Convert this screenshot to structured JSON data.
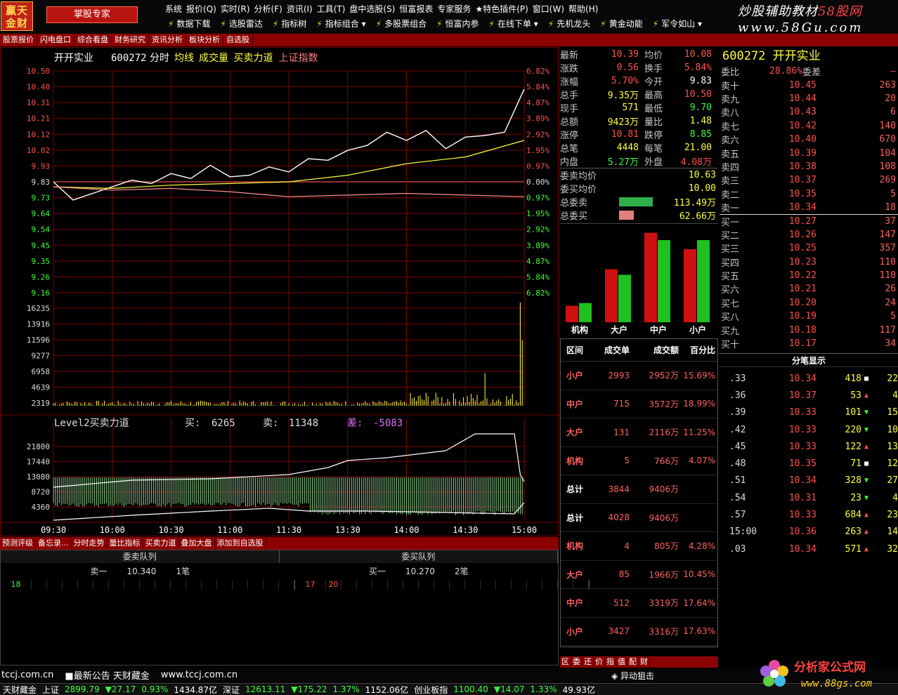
{
  "app": {
    "logo_line1": "赢天",
    "logo_line2": "金财",
    "expert_button": "掌股专家",
    "brand_line1_a": "炒股辅助教材",
    "brand_line1_b": "58股网",
    "brand_line2": "www.58Gu.com"
  },
  "menu": [
    "系统",
    "报价(Q)",
    "实时(R)",
    "分析(F)",
    "资讯(I)",
    "工具(T)",
    "盘中选股(S)",
    "恒富报表",
    "专家服务",
    "★特色插件(P)",
    "窗口(W)",
    "帮助(H)"
  ],
  "toolbar": [
    "数据下载",
    "选股雷达",
    "指标树",
    "指标组合 ▾",
    "多股票组合",
    "恒富内参",
    "在线下单 ▾",
    "先机龙头",
    "黄金动能",
    "军令如山 ▾"
  ],
  "nav_tabs": [
    "股票报价",
    "闪电盘口",
    "综合看盘",
    "财务研究",
    "资讯分析",
    "板块分析",
    "自选股"
  ],
  "chart": {
    "header_name": "开开实业",
    "header_code": "600272",
    "header_items": [
      "分时",
      "均线",
      "成交量",
      "买卖力道",
      "上证指数"
    ],
    "price_ticks": [
      "10.50",
      "10.40",
      "10.31",
      "10.21",
      "10.12",
      "10.02",
      "9.93",
      "9.83",
      "9.73",
      "9.64",
      "9.54",
      "9.45",
      "9.35",
      "9.26",
      "9.16"
    ],
    "pct_ticks": [
      "6.82%",
      "5.84%",
      "4.87%",
      "3.89%",
      "2.92%",
      "1.95%",
      "0.97%",
      "0.00%",
      "0.97%",
      "1.95%",
      "2.92%",
      "3.89%",
      "4.87%",
      "5.84%",
      "6.82%"
    ],
    "volume_ticks": [
      "16235",
      "13916",
      "11596",
      "9277",
      "6958",
      "4639",
      "2319"
    ],
    "level2_title": "Level2买卖力道",
    "level2_buy_label": "买:",
    "level2_buy": "6265",
    "level2_sell_label": "卖:",
    "level2_sell": "11348",
    "level2_diff_label": "差:",
    "level2_diff": "-5083",
    "power_ticks": [
      "21800",
      "17440",
      "13080",
      "8720",
      "4360"
    ],
    "time_ticks": [
      "09:30",
      "10:00",
      "10:30",
      "11:00",
      "11:30",
      "13:30",
      "14:00",
      "14:30",
      "15:00"
    ]
  },
  "chart_data": {
    "type": "line",
    "title": "",
    "x_labels": [
      "09:30",
      "10:00",
      "10:30",
      "11:00",
      "11:30",
      "13:30",
      "14:00",
      "14:30",
      "15:00"
    ],
    "price_ylim": [
      9.16,
      10.5
    ],
    "prev_close": 9.83,
    "series": [
      {
        "name": "分时",
        "x": [
          0,
          10,
          20,
          30,
          40,
          50,
          60,
          70,
          80,
          90,
          100,
          110,
          120,
          130,
          140,
          150,
          160,
          170,
          180,
          190,
          200,
          210,
          220,
          230,
          240
        ],
        "values": [
          9.83,
          9.72,
          9.76,
          9.8,
          9.84,
          9.82,
          9.88,
          9.85,
          9.93,
          9.86,
          9.87,
          9.92,
          9.89,
          9.97,
          9.96,
          10.02,
          10.05,
          10.13,
          10.08,
          10.14,
          10.03,
          10.1,
          10.11,
          10.13,
          10.39
        ]
      },
      {
        "name": "均线",
        "x": [
          0,
          30,
          60,
          90,
          120,
          150,
          180,
          210,
          240
        ],
        "values": [
          9.8,
          9.79,
          9.81,
          9.82,
          9.83,
          9.87,
          9.94,
          9.98,
          10.08
        ]
      },
      {
        "name": "上证指数",
        "x": [
          0,
          30,
          60,
          90,
          120,
          150,
          180,
          210,
          240
        ],
        "values": [
          9.8,
          9.78,
          9.79,
          9.77,
          9.74,
          9.75,
          9.76,
          9.75,
          9.74
        ]
      }
    ]
  },
  "quote": {
    "rows": [
      {
        "l": "最新",
        "v": "10.39",
        "vc": "red",
        "l2": "均价",
        "v2": "10.08",
        "v2c": "red"
      },
      {
        "l": "涨跌",
        "v": "0.56",
        "vc": "red",
        "l2": "换手",
        "v2": "5.84%",
        "v2c": "red"
      },
      {
        "l": "涨幅",
        "v": "5.70%",
        "vc": "red",
        "l2": "今开",
        "v2": "9.83",
        "v2c": "wht"
      },
      {
        "l": "总手",
        "v": "9.35万",
        "vc": "yel",
        "l2": "最高",
        "v2": "10.50",
        "v2c": "red"
      },
      {
        "l": "现手",
        "v": "571",
        "vc": "yel",
        "l2": "最低",
        "v2": "9.70",
        "v2c": "green"
      },
      {
        "l": "总额",
        "v": "9423万",
        "vc": "yel",
        "l2": "量比",
        "v2": "1.48",
        "v2c": "yel"
      },
      {
        "l": "涨停",
        "v": "10.81",
        "vc": "red",
        "l2": "跌停",
        "v2": "8.85",
        "v2c": "green"
      },
      {
        "l": "总笔",
        "v": "4448",
        "vc": "yel",
        "l2": "每笔",
        "v2": "21.00",
        "v2c": "yel"
      },
      {
        "l": "内盘",
        "v": "5.27万",
        "vc": "green",
        "l2": "外盘",
        "v2": "4.08万",
        "v2c": "red"
      }
    ],
    "weituo": [
      {
        "l": "委卖均价",
        "v": "10.63"
      },
      {
        "l": "委买均价",
        "v": "10.00"
      },
      {
        "l": "总委卖",
        "v": "113.49万",
        "bar": 0.8,
        "color": "#2fb04a"
      },
      {
        "l": "总委买",
        "v": "62.66万",
        "bar": 0.35,
        "color": "#e08080"
      }
    ]
  },
  "bars": {
    "labels": [
      "机构",
      "大户",
      "中户",
      "小户"
    ],
    "pairs": [
      [
        0.18,
        0.21
      ],
      [
        0.58,
        0.52
      ],
      [
        0.98,
        0.9
      ],
      [
        0.8,
        0.9
      ]
    ]
  },
  "flow": {
    "headers": [
      "区间",
      "成交单",
      "成交额",
      "百分比"
    ],
    "rows": [
      {
        "n": "小户",
        "a": "2993",
        "b": "2952万",
        "p": "15.69%"
      },
      {
        "n": "中户",
        "a": "715",
        "b": "3572万",
        "p": "18.99%"
      },
      {
        "n": "大户",
        "a": "131",
        "b": "2116万",
        "p": "11.25%"
      },
      {
        "n": "机构",
        "a": "5",
        "b": "766万",
        "p": "4.07%"
      },
      {
        "n": "总计",
        "a": "3844",
        "b": "9406万",
        "p": ""
      },
      {
        "n": "总计",
        "a": "4028",
        "b": "9406万",
        "p": ""
      },
      {
        "n": "机构",
        "a": "4",
        "b": "805万",
        "p": "4.28%"
      },
      {
        "n": "大户",
        "a": "85",
        "b": "1966万",
        "p": "10.45%"
      },
      {
        "n": "中户",
        "a": "512",
        "b": "3319万",
        "p": "17.64%"
      },
      {
        "n": "小户",
        "a": "3427",
        "b": "3316万",
        "p": "17.63%"
      }
    ]
  },
  "small_tabs": [
    "区",
    "委",
    "还",
    "价",
    "指",
    "值",
    "配",
    "财"
  ],
  "order_book": {
    "title": "600272 开开实业",
    "weibi_label": "委比",
    "weibi": "28.86%",
    "weicha_label": "委差",
    "weicha": "—",
    "sells": [
      {
        "l": "卖十",
        "p": "10.45",
        "q": "263"
      },
      {
        "l": "卖九",
        "p": "10.44",
        "q": "20"
      },
      {
        "l": "卖八",
        "p": "10.43",
        "q": "6"
      },
      {
        "l": "卖七",
        "p": "10.42",
        "q": "140"
      },
      {
        "l": "卖六",
        "p": "10.40",
        "q": "670"
      },
      {
        "l": "卖五",
        "p": "10.39",
        "q": "104"
      },
      {
        "l": "卖四",
        "p": "10.38",
        "q": "108"
      },
      {
        "l": "卖三",
        "p": "10.37",
        "q": "269"
      },
      {
        "l": "卖二",
        "p": "10.35",
        "q": "5"
      },
      {
        "l": "卖一",
        "p": "10.34",
        "q": "18"
      }
    ],
    "buys": [
      {
        "l": "买一",
        "p": "10.27",
        "q": "37"
      },
      {
        "l": "买二",
        "p": "10.26",
        "q": "147"
      },
      {
        "l": "买三",
        "p": "10.25",
        "q": "357"
      },
      {
        "l": "买四",
        "p": "10.23",
        "q": "110"
      },
      {
        "l": "买五",
        "p": "10.22",
        "q": "110"
      },
      {
        "l": "买六",
        "p": "10.21",
        "q": "26"
      },
      {
        "l": "买七",
        "p": "10.20",
        "q": "24"
      },
      {
        "l": "买八",
        "p": "10.19",
        "q": "5"
      },
      {
        "l": "买九",
        "p": "10.18",
        "q": "117"
      },
      {
        "l": "买十",
        "p": "10.17",
        "q": "34"
      }
    ]
  },
  "ticks_title": "分笔显示",
  "ticks": [
    {
      "t": ".33",
      "p": "10.34",
      "v": "418",
      "d": "■",
      "dc": "wht",
      "n": "22"
    },
    {
      "t": ".36",
      "p": "10.37",
      "v": "53",
      "d": "▲",
      "dc": "red",
      "n": "4"
    },
    {
      "t": ".39",
      "p": "10.33",
      "v": "101",
      "d": "▼",
      "dc": "green",
      "n": "15"
    },
    {
      "t": ".42",
      "p": "10.33",
      "v": "220",
      "d": "▼",
      "dc": "green",
      "n": "10"
    },
    {
      "t": ".45",
      "p": "10.33",
      "v": "122",
      "d": "▲",
      "dc": "red",
      "n": "13"
    },
    {
      "t": ".48",
      "p": "10.35",
      "v": "71",
      "d": "■",
      "dc": "wht",
      "n": "12"
    },
    {
      "t": ".51",
      "p": "10.34",
      "v": "328",
      "d": "▼",
      "dc": "green",
      "n": "27"
    },
    {
      "t": ".54",
      "p": "10.31",
      "v": "23",
      "d": "▼",
      "dc": "green",
      "n": "4"
    },
    {
      "t": ".57",
      "p": "10.33",
      "v": "684",
      "d": "▲",
      "dc": "red",
      "n": "23"
    },
    {
      "t": "15:00",
      "p": "10.36",
      "v": "263",
      "d": "▲",
      "dc": "red",
      "n": "14"
    },
    {
      "t": ".03",
      "p": "10.34",
      "v": "571",
      "d": "▲",
      "dc": "red",
      "n": "32"
    }
  ],
  "sub_tabs": [
    "预测评级",
    "备忘录...",
    "分时走势",
    "量比指标",
    "买卖力道",
    "叠加大盘",
    "添加到自选股"
  ],
  "queue": {
    "sell_title": "委卖队列",
    "buy_title": "委买队列",
    "sell_level": "卖一",
    "sell_price": "10.340",
    "sell_count": "1笔",
    "buy_level": "买一",
    "buy_price": "10.270",
    "buy_count": "2笔",
    "sell_cells": [
      "18"
    ],
    "buy_cells": [
      "17",
      "20"
    ]
  },
  "status": {
    "site": "tccj.com.cn",
    "notice": "最新公告",
    "notice2": "天财藏金",
    "site2": "www.tccj.com.cn",
    "alert": "异动狙击",
    "bottom": [
      {
        "t": "天财藏金",
        "c": "wht"
      },
      {
        "t": "上证",
        "c": "wht"
      },
      {
        "t": "2899.79",
        "c": "green"
      },
      {
        "t": "▼27.17",
        "c": "green"
      },
      {
        "t": "0.93%",
        "c": "green"
      },
      {
        "t": "1434.87亿",
        "c": "wht"
      },
      {
        "t": "深证",
        "c": "wht"
      },
      {
        "t": "12613.11",
        "c": "green"
      },
      {
        "t": "▼175.22",
        "c": "green"
      },
      {
        "t": "1.37%",
        "c": "green"
      },
      {
        "t": "1152.06亿",
        "c": "wht"
      },
      {
        "t": "创业板指",
        "c": "wht"
      },
      {
        "t": "1100.40",
        "c": "green"
      },
      {
        "t": "▼14.07",
        "c": "green"
      },
      {
        "t": "1.33%",
        "c": "green"
      },
      {
        "t": "49.93亿",
        "c": "wht"
      }
    ]
  },
  "watermark2": {
    "line1": "分析家公式网",
    "line2": "www.88gs.com"
  },
  "colors": {
    "up": "#ff5050",
    "down": "#3cff3c",
    "grid": "#7a0000",
    "accent": "#8c0000"
  }
}
